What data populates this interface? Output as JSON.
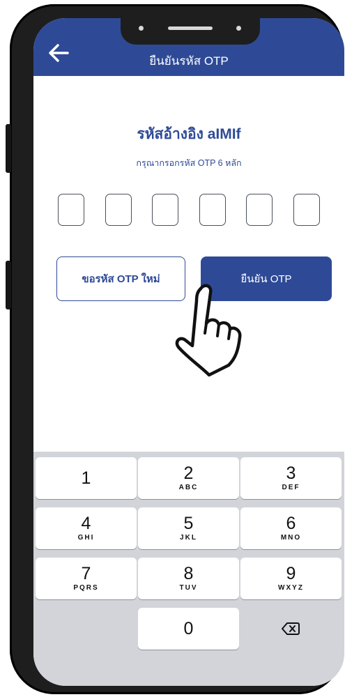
{
  "header": {
    "title": "ยืนยันรหัส OTP"
  },
  "otp": {
    "reference_label": "รหัสอ้างอิง aIMIf",
    "instruction": "กรุณากรอกรหัส OTP 6 หลัก",
    "digits": [
      "",
      "",
      "",
      "",
      "",
      ""
    ]
  },
  "buttons": {
    "resend_label": "ขอรหัส OTP ใหม่",
    "confirm_label": "ยืนยัน OTP"
  },
  "keypad": {
    "keys": [
      {
        "num": "1",
        "letters": ""
      },
      {
        "num": "2",
        "letters": "ABC"
      },
      {
        "num": "3",
        "letters": "DEF"
      },
      {
        "num": "4",
        "letters": "GHI"
      },
      {
        "num": "5",
        "letters": "JKL"
      },
      {
        "num": "6",
        "letters": "MNO"
      },
      {
        "num": "7",
        "letters": "PQRS"
      },
      {
        "num": "8",
        "letters": "TUV"
      },
      {
        "num": "9",
        "letters": "WXYZ"
      },
      {
        "num": "0",
        "letters": ""
      }
    ],
    "delete_icon": "backspace-icon"
  },
  "colors": {
    "brand": "#2e4a97",
    "keypad_bg": "#d2d4da"
  }
}
